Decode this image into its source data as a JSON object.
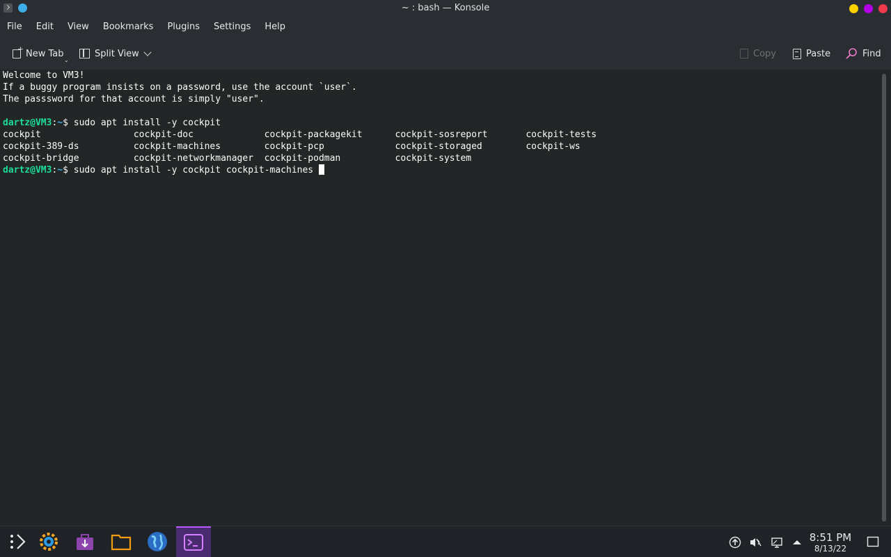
{
  "window": {
    "title": "~ : bash — Konsole",
    "buttons": [
      "minimize-icon",
      "maximize-icon",
      "close-icon"
    ],
    "button_colors": {
      "minimize": "#fdd100",
      "maximize": "#b400e6",
      "close": "#ee3a4a"
    }
  },
  "menu": {
    "items": [
      "File",
      "Edit",
      "View",
      "Bookmarks",
      "Plugins",
      "Settings",
      "Help"
    ]
  },
  "toolbar": {
    "new_tab": "New Tab",
    "split_view": "Split View",
    "copy": "Copy",
    "paste": "Paste",
    "find": "Find"
  },
  "terminal": {
    "welcome": [
      "Welcome to VM3!",
      "If a buggy program insists on a password, use the account `user`.",
      "The passsword for that account is simply \"user\"."
    ],
    "prompt_user": "dartz@VM3",
    "prompt_path": "~",
    "prompt_symbol": "$",
    "command1": " sudo apt install -y cockpit",
    "completions": [
      "cockpit                 cockpit-doc             cockpit-packagekit      cockpit-sosreport       cockpit-tests",
      "cockpit-389-ds          cockpit-machines        cockpit-pcp             cockpit-storaged        cockpit-ws",
      "cockpit-bridge          cockpit-networkmanager  cockpit-podman          cockpit-system"
    ],
    "command2": " sudo apt install -y cockpit cockpit-machines ",
    "colors": {
      "user": "#1cdc9a",
      "path": "#3daee9",
      "background": "#232627"
    }
  },
  "taskbar": {
    "apps": [
      "application-launcher-icon",
      "system-settings-icon",
      "discover-icon",
      "file-manager-icon",
      "web-browser-icon",
      "konsole-icon"
    ],
    "tray": [
      "updates-icon",
      "volume-muted-icon",
      "network-icon",
      "expand-tray-icon"
    ],
    "clock_time": "8:51 PM",
    "clock_date": "8/13/22",
    "active_accent": "#b657ff"
  }
}
